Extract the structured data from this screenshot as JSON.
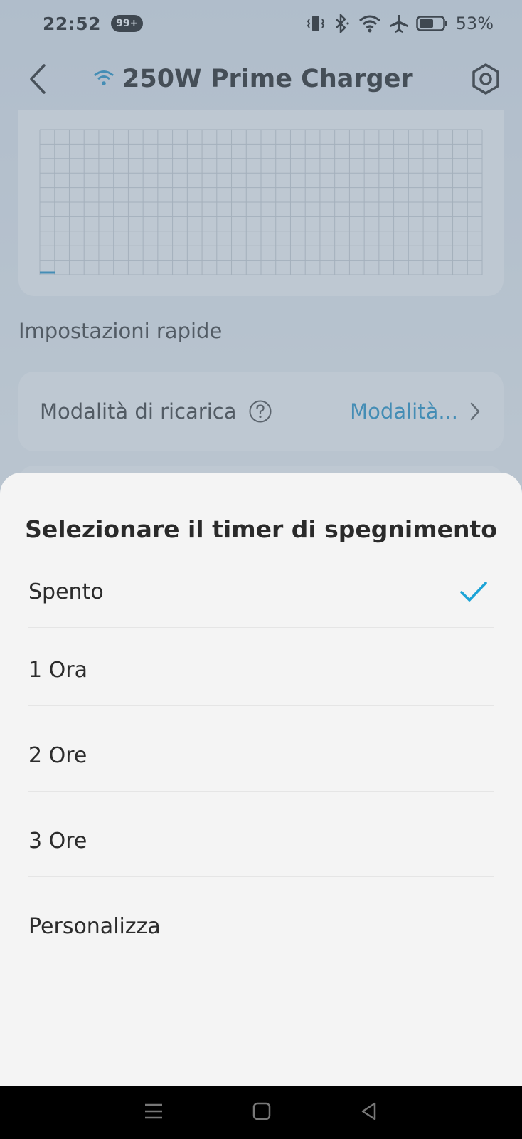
{
  "status_bar": {
    "time": "22:52",
    "notification_badge": "99+",
    "battery_percent": "53%",
    "icons": [
      "vibrate-icon",
      "bluetooth-icon",
      "wifi-icon",
      "airplane-icon",
      "battery-icon"
    ]
  },
  "header": {
    "title": "250W Prime Charger",
    "icons": [
      "back-icon",
      "wifi-icon",
      "settings-icon"
    ]
  },
  "quick_settings": {
    "section_title": "Impostazioni rapide",
    "rows": [
      {
        "label": "Modalità di ricarica",
        "value": "Modalità...",
        "help_icon": "question-icon"
      }
    ]
  },
  "sheet": {
    "title": "Selezionare il timer di spegnimento",
    "options": [
      {
        "label": "Spento",
        "selected": true
      },
      {
        "label": "1 Ora",
        "selected": false
      },
      {
        "label": "2 Ore",
        "selected": false
      },
      {
        "label": "3 Ore",
        "selected": false
      },
      {
        "label": "Personalizza",
        "selected": false
      }
    ]
  },
  "colors": {
    "accent": "#1a8fc6",
    "check": "#1ba3d6",
    "overlay": "rgba(120,140,160,0.45)"
  },
  "nav_bar": {
    "icons": [
      "menu-icon",
      "home-icon",
      "back-triangle-icon"
    ]
  }
}
